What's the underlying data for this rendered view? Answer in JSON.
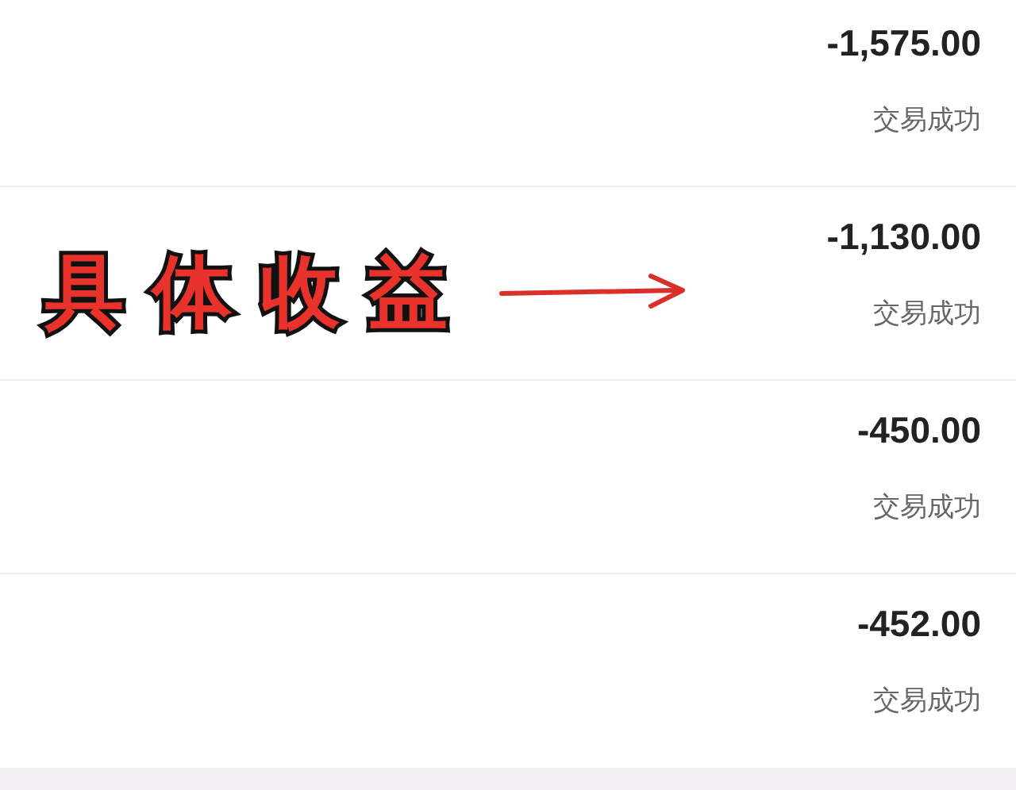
{
  "transactions": [
    {
      "amount": "-1,575.00",
      "status": "交易成功"
    },
    {
      "amount": "-1,130.00",
      "status": "交易成功",
      "annotation": "具体收益"
    },
    {
      "amount": "-450.00",
      "status": "交易成功"
    },
    {
      "amount": "-452.00",
      "status": "交易成功"
    }
  ]
}
